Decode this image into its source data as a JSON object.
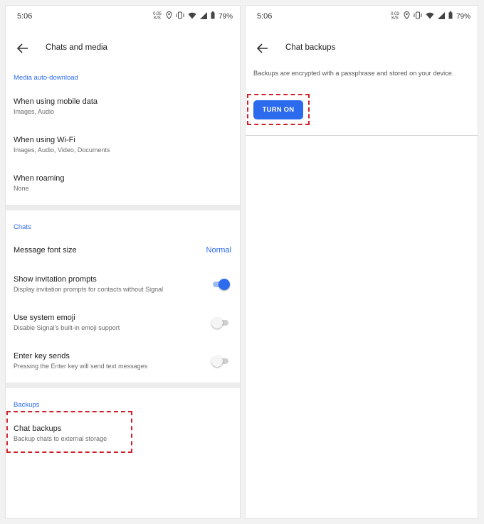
{
  "left_screen": {
    "status": {
      "time": "5:06",
      "net_speed": "0.05\nK/S",
      "battery": "79%"
    },
    "app_bar": {
      "title": "Chats and media"
    },
    "media_section": {
      "header": "Media auto-download",
      "items": [
        {
          "title": "When using mobile data",
          "summary": "Images, Audio"
        },
        {
          "title": "When using Wi-Fi",
          "summary": "Images, Audio, Video, Documents"
        },
        {
          "title": "When roaming",
          "summary": "None"
        }
      ]
    },
    "chats_section": {
      "header": "Chats",
      "font_size": {
        "title": "Message font size",
        "value": "Normal"
      },
      "invitation": {
        "title": "Show invitation prompts",
        "summary": "Display invitation prompts for contacts without Signal",
        "enabled": true
      },
      "emoji": {
        "title": "Use system emoji",
        "summary": "Disable Signal's built-in emoji support",
        "enabled": false
      },
      "enter_key": {
        "title": "Enter key sends",
        "summary": "Pressing the Enter key will send text messages",
        "enabled": false
      }
    },
    "backups_section": {
      "header": "Backups",
      "chat_backups": {
        "title": "Chat backups",
        "summary": "Backup chats to external storage"
      }
    }
  },
  "right_screen": {
    "status": {
      "time": "5:06",
      "net_speed": "0.03\nK/S",
      "battery": "79%"
    },
    "app_bar": {
      "title": "Chat backups"
    },
    "description": "Backups are encrypted with a passphrase and stored on your device.",
    "turn_on_label": "TURN ON"
  },
  "colors": {
    "accent": "#2c6bed",
    "highlight": "#d0202a"
  },
  "icons": [
    "back-arrow-icon",
    "location-icon",
    "vibrate-icon",
    "wifi-icon",
    "cellular-signal-icon",
    "battery-icon"
  ]
}
